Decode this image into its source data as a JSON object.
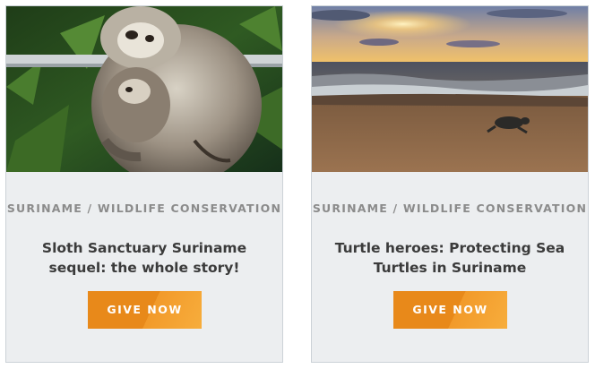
{
  "cards": [
    {
      "category": "SURINAME / WILDLIFE CONSERVATION",
      "title": "Sloth Sanctuary Suriname sequel: the whole story!",
      "button_label": "GIVE NOW",
      "image": "sloth-mother-and-baby-photo"
    },
    {
      "category": "SURINAME / WILDLIFE CONSERVATION",
      "title": "Turtle heroes: Protecting Sea Turtles in Suriname",
      "button_label": "GIVE NOW",
      "image": "beach-sunset-sea-turtle-photo"
    }
  ]
}
